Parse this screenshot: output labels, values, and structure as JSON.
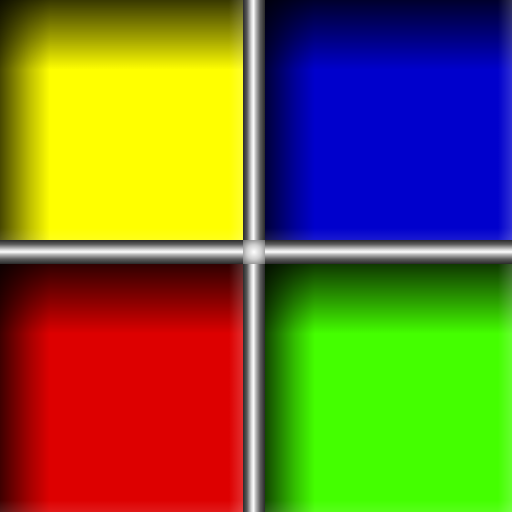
{
  "pads": [
    {
      "id": "pad-yellow",
      "name": "pad-yellow",
      "color": "#ffff00"
    },
    {
      "id": "pad-blue",
      "name": "pad-blue",
      "color": "#0000cc"
    },
    {
      "id": "pad-red",
      "name": "pad-red",
      "color": "#dd0000"
    },
    {
      "id": "pad-green",
      "name": "pad-green",
      "color": "#44ff00"
    }
  ]
}
